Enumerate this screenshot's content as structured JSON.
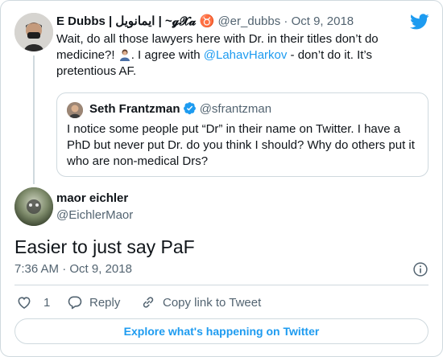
{
  "colors": {
    "link": "#1d9bf0",
    "muted": "#536471",
    "border": "#cfd9de",
    "text": "#0f1419"
  },
  "outer_tweet": {
    "display_name": "E Dubbs | ایمانویل | ~𝓰𝓧𝓪 ♉",
    "handle": "@er_dubbs",
    "separator": "·",
    "date": "Oct 9, 2018",
    "text_part1": "Wait, do all those lawyers here with Dr. in their titles don’t do medicine?! ",
    "text_part2": ". I agree with ",
    "mention": "@LahavHarkov",
    "text_part3": " - don’t do it. It’s pretentious AF."
  },
  "quoted_tweet": {
    "display_name": "Seth Frantzman",
    "handle": "@sfrantzman",
    "text": "I notice some people put “Dr” in their name on Twitter. I have a PhD but never put Dr. do you think I should? Why do others put it who are non-medical Drs?"
  },
  "main_tweet": {
    "display_name": "maor eichler",
    "handle": "@EichlerMaor",
    "text": "Easier to just say PaF",
    "time": "7:36 AM",
    "separator": "·",
    "date": "Oct 9, 2018"
  },
  "actions": {
    "like_count": "1",
    "reply_label": "Reply",
    "copy_label": "Copy link to Tweet"
  },
  "explore_label": "Explore what's happening on Twitter",
  "icons": [
    "twitter-bird-icon",
    "verified-badge-icon",
    "person-emoji-icon",
    "info-icon",
    "heart-icon",
    "reply-icon",
    "link-icon"
  ]
}
